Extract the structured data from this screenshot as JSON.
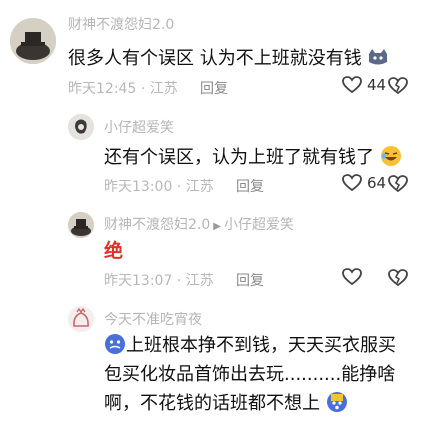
{
  "comments": [
    {
      "username": "财神不渡怨妇2.0",
      "text": "很多人有个误区 认为不上班就没有钱",
      "time": "昨天12:45 · 江苏",
      "reply": "回复",
      "likes": "44"
    },
    {
      "username": "小仔超爱笑",
      "text": "还有个误区，认为上班了就有钱了",
      "time": "昨天13:00 · 江苏",
      "reply": "回复",
      "likes": "64"
    },
    {
      "username": "财神不渡怨妇2.0",
      "reply_to": "小仔超爱笑",
      "text": "绝",
      "time": "昨天13:07 · 江苏",
      "reply": "回复",
      "likes": ""
    },
    {
      "username": "今天不准吃宵夜",
      "lines": [
        "上班根本挣不到钱，天天买衣服买",
        "包买化妆品首饰出去玩..........能挣啥",
        "啊，不花钱的话班都不想上"
      ]
    }
  ],
  "colors": {
    "accent_red": "#e0302a",
    "meta_gray": "#b8b8b8"
  },
  "icons": [
    "heart-icon",
    "dislike-heart-icon",
    "reply-arrow-icon"
  ]
}
